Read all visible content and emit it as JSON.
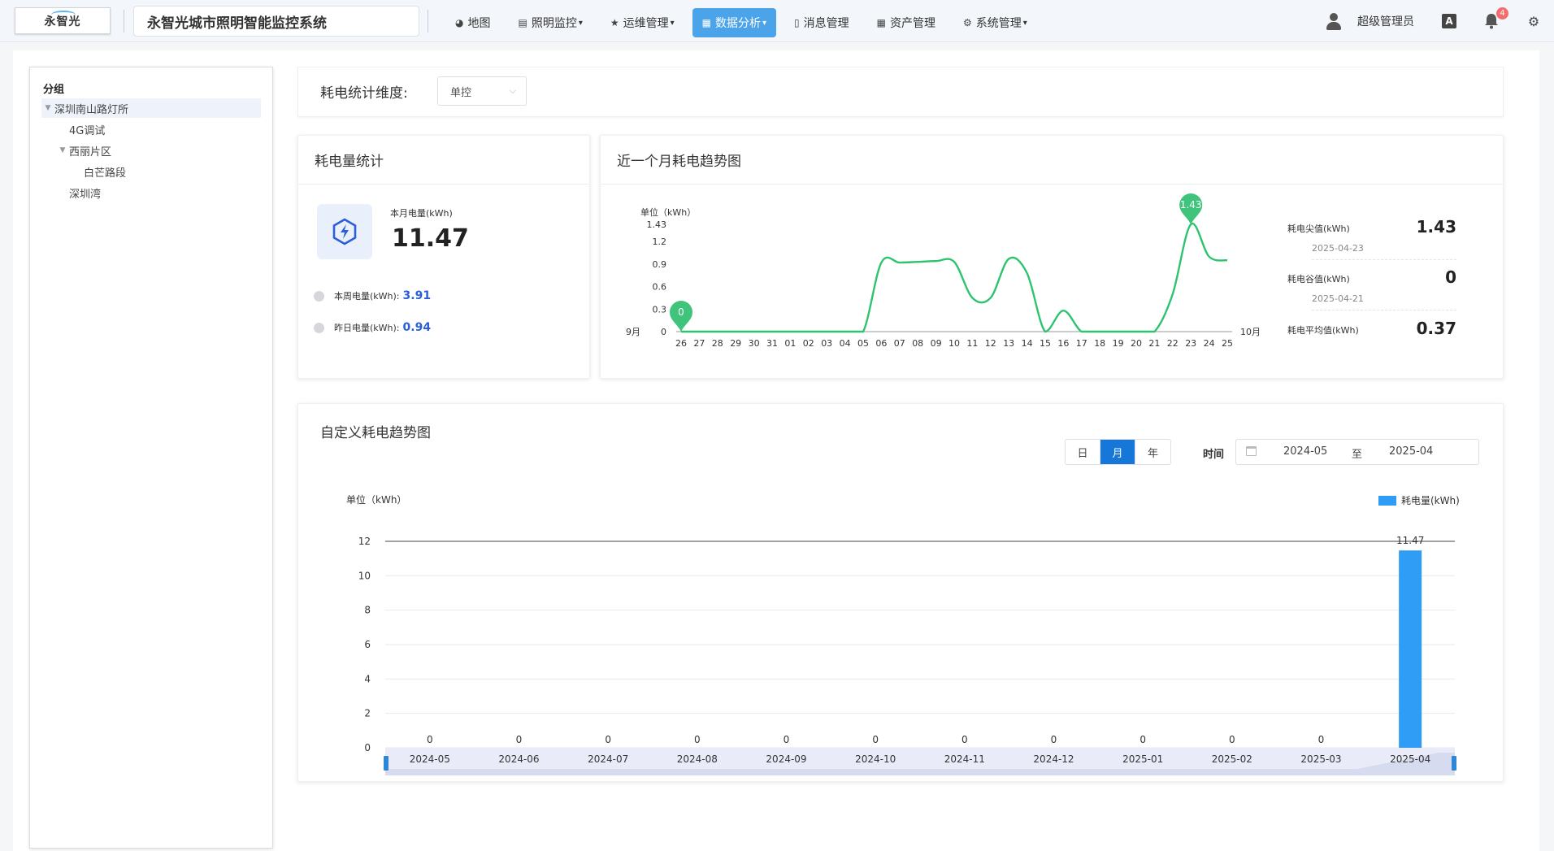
{
  "header": {
    "logo_text": "永智光",
    "system_title": "永智光城市照明智能监控系统",
    "nav": [
      {
        "label": "地图",
        "icon": "dashboard-icon",
        "glyph": "◕",
        "caret": ""
      },
      {
        "label": "照明监控",
        "icon": "monitor-icon",
        "glyph": "▤",
        "caret": "▾"
      },
      {
        "label": "运维管理",
        "icon": "star-icon",
        "glyph": "★",
        "caret": "▾"
      },
      {
        "label": "数据分析",
        "icon": "chart-icon",
        "glyph": "▦",
        "caret": "▾"
      },
      {
        "label": "消息管理",
        "icon": "message-icon",
        "glyph": "▯",
        "caret": ""
      },
      {
        "label": "资产管理",
        "icon": "table-icon",
        "glyph": "▦",
        "caret": ""
      },
      {
        "label": "系统管理",
        "icon": "gear-icon",
        "glyph": "⚙",
        "caret": "▾"
      }
    ],
    "active_nav_index": 3,
    "user_name": "超级管理员",
    "lang_glyph": "A",
    "notification_count": "4",
    "colors": {
      "active_nav": "#4ba3ea",
      "badge": "#f56c6c"
    }
  },
  "sidebar": {
    "title": "分组",
    "tree": [
      {
        "label": "深圳南山路灯所",
        "level": 0,
        "expanded": true,
        "selected": true
      },
      {
        "label": "4G调试",
        "level": 1,
        "expanded": false,
        "selected": false
      },
      {
        "label": "西丽片区",
        "level": 1,
        "expanded": true,
        "selected": false
      },
      {
        "label": "白芒路段",
        "level": 2,
        "expanded": false,
        "selected": false
      },
      {
        "label": "深圳湾",
        "level": 1,
        "expanded": false,
        "selected": false
      }
    ]
  },
  "filter": {
    "label": "耗电统计维度:",
    "selected": "单控"
  },
  "stats_card": {
    "title": "耗电量统计",
    "month_label": "本月电量(kWh)",
    "month_value": "11.47",
    "week_label": "本周电量(kWh):",
    "week_value": "3.91",
    "yesterday_label": "昨日电量(kWh):",
    "yesterday_value": "0.94",
    "accent": "#2b5fd8"
  },
  "trend_card": {
    "title": "近一个月耗电趋势图",
    "peak_label": "耗电尖值(kWh)",
    "peak_value": "1.43",
    "peak_date": "2025-04-23",
    "valley_label": "耗电谷值(kWh)",
    "valley_value": "0",
    "valley_date": "2025-04-21",
    "avg_label": "耗电平均值(kWh)",
    "avg_value": "0.37"
  },
  "custom_card": {
    "title": "自定义耗电趋势图",
    "periods": [
      "日",
      "月",
      "年"
    ],
    "active_period": "月",
    "time_label": "时间",
    "range_start": "2024-05",
    "range_sep": "至",
    "range_end": "2025-04"
  },
  "chart_data": [
    {
      "type": "line",
      "unit_label": "单位（kWh）",
      "x_start_marker": "9月",
      "x_end_marker": "10月",
      "x": [
        "26",
        "27",
        "28",
        "29",
        "30",
        "31",
        "01",
        "02",
        "03",
        "04",
        "05",
        "06",
        "07",
        "08",
        "09",
        "10",
        "11",
        "12",
        "13",
        "14",
        "15",
        "16",
        "17",
        "18",
        "19",
        "20",
        "21",
        "22",
        "23",
        "24",
        "25"
      ],
      "values": [
        0,
        0,
        0,
        0,
        0,
        0,
        0,
        0,
        0,
        0,
        0,
        0.92,
        0.92,
        0.93,
        0.94,
        0.93,
        0.45,
        0.45,
        0.97,
        0.78,
        0,
        0.28,
        0,
        0,
        0,
        0,
        0,
        0.5,
        1.43,
        1.0,
        0.95
      ],
      "yticks": [
        "0",
        "0.3",
        "0.6",
        "0.9",
        "1.2",
        "1.43"
      ],
      "ylim": [
        0,
        1.43
      ],
      "markers": [
        {
          "label": "0",
          "index": 0
        },
        {
          "label": "1.43",
          "index": 28
        }
      ],
      "color": "#2ec36f"
    },
    {
      "type": "bar",
      "unit_label": "单位（kWh）",
      "legend": "耗电量(kWh)",
      "categories": [
        "2024-05",
        "2024-06",
        "2024-07",
        "2024-08",
        "2024-09",
        "2024-10",
        "2024-11",
        "2024-12",
        "2025-01",
        "2025-02",
        "2025-03",
        "2025-04"
      ],
      "values": [
        0,
        0,
        0,
        0,
        0,
        0,
        0,
        0,
        0,
        0,
        0,
        11.47
      ],
      "value_labels": [
        "0",
        "0",
        "0",
        "0",
        "0",
        "0",
        "0",
        "0",
        "0",
        "0",
        "0",
        "11.47"
      ],
      "yticks": [
        "0",
        "2",
        "4",
        "6",
        "8",
        "10",
        "12"
      ],
      "ylim": [
        0,
        12
      ],
      "color": "#2f9cf5"
    }
  ]
}
